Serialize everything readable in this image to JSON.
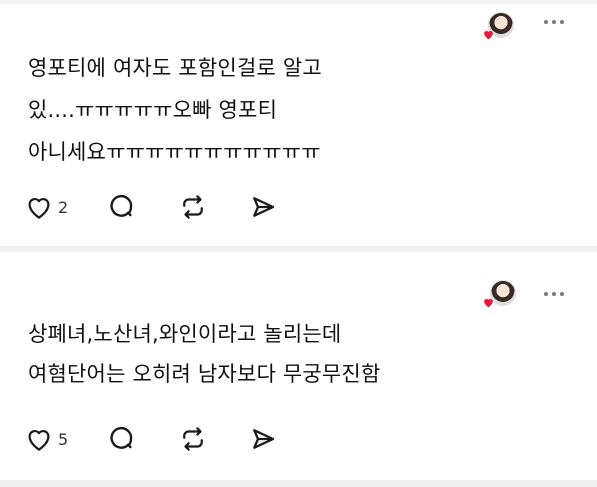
{
  "posts": [
    {
      "lines": [
        "영포티에 여자도 포함인걸로 알고",
        "있....ㅠㅠㅠㅠㅠ오빠 영포티",
        "아니세요ㅠㅠㅠㅠㅠㅠㅠㅠㅠㅠㅠ"
      ],
      "like_count": "2"
    },
    {
      "lines": [
        "상폐녀,노산녀,와인이라고 놀리는데",
        "여혐단어는 오히려 남자보다 무궁무진함"
      ],
      "like_count": "5"
    }
  ],
  "icons": {
    "like": "heart-outline-icon",
    "comment": "comment-bubble-icon",
    "repost": "repost-arrows-icon",
    "share": "send-paper-plane-icon",
    "more": "more-dots-icon",
    "badge": "heart-filled-icon"
  },
  "colors": {
    "badge_red": "#e8193c",
    "icon": "#1a1a1a",
    "divider": "#f0f0f0"
  }
}
